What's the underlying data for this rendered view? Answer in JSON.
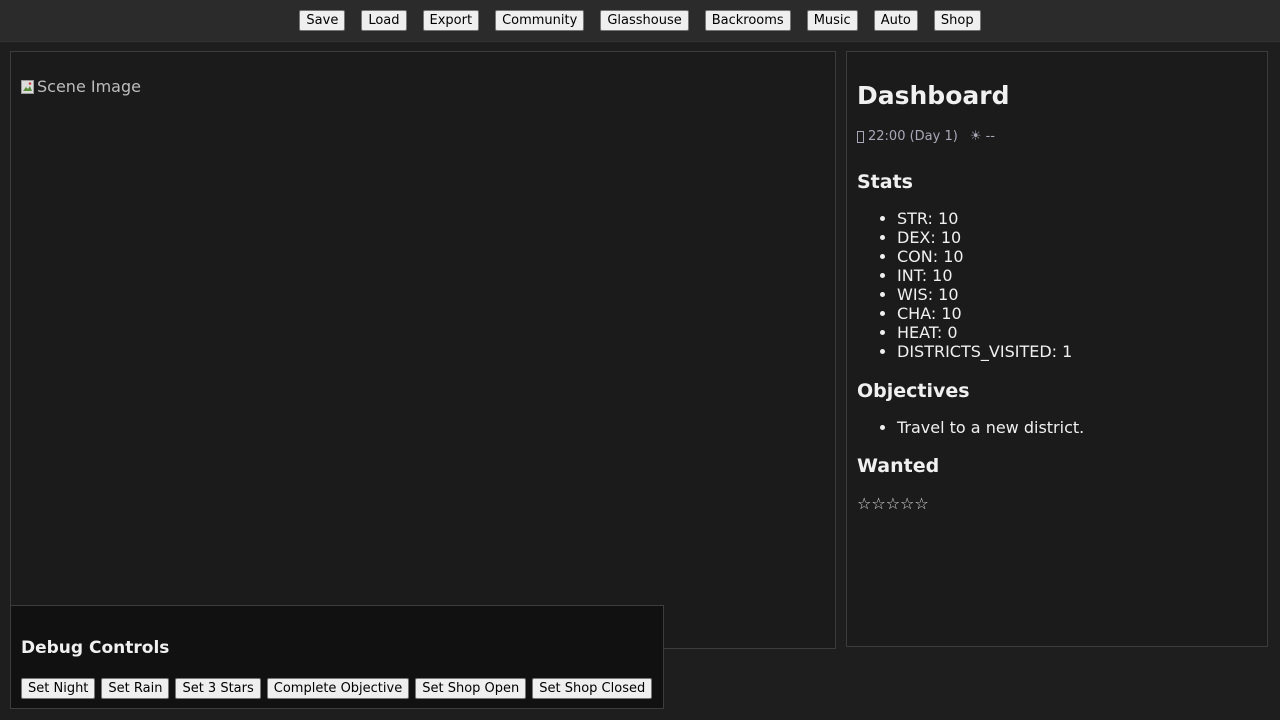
{
  "toolbar": {
    "buttons": [
      "Save",
      "Load",
      "Export",
      "Community",
      "Glasshouse",
      "Backrooms",
      "Music",
      "Auto",
      "Shop"
    ]
  },
  "scene": {
    "image_alt": "Scene Image"
  },
  "dashboard": {
    "title": "Dashboard",
    "time": "22:00 (Day 1)",
    "weather": "☀ --",
    "stats_title": "Stats",
    "stats": [
      "STR: 10",
      "DEX: 10",
      "CON: 10",
      "INT: 10",
      "WIS: 10",
      "CHA: 10",
      "HEAT: 0",
      "DISTRICTS_VISITED: 1"
    ],
    "objectives_title": "Objectives",
    "objectives": [
      "Travel to a new district."
    ],
    "wanted_title": "Wanted",
    "wanted_stars": "☆☆☆☆☆",
    "wanted_level": 0,
    "wanted_max": 5
  },
  "debug": {
    "title": "Debug Controls",
    "buttons": [
      "Set Night",
      "Set Rain",
      "Set 3 Stars",
      "Complete Objective",
      "Set Shop Open",
      "Set Shop Closed"
    ]
  }
}
